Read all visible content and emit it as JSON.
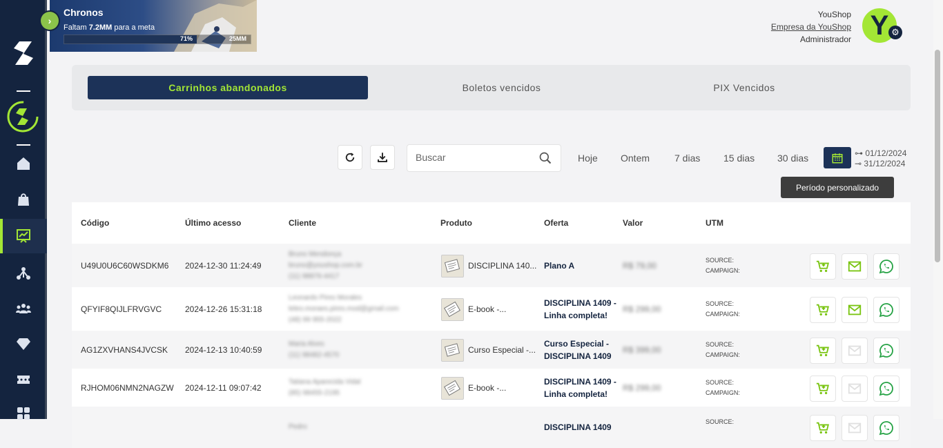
{
  "colors": {
    "accent": "#a3e635",
    "navy": "#14243f",
    "active_tab": "#1c3258",
    "whatsapp": "#25a244"
  },
  "banner": {
    "title": "Chronos",
    "sub_prefix": "Faltam ",
    "sub_amount": "7.2MM",
    "sub_suffix": " para a meta",
    "progress": 0.71,
    "progress_label": "71%",
    "goal_label": "25MM"
  },
  "user": {
    "name": "YouShop",
    "company": "Empresa da YouShop",
    "role": "Administrador",
    "avatar_letter": "Y"
  },
  "sidebar": {
    "items": [
      {
        "icon": "home-icon"
      },
      {
        "icon": "bag-icon"
      },
      {
        "icon": "presentation-chart-icon",
        "active": true
      },
      {
        "icon": "network-icon"
      },
      {
        "icon": "users-icon"
      },
      {
        "icon": "diamond-icon"
      },
      {
        "icon": "ticket-icon"
      },
      {
        "icon": "apps-icon"
      }
    ]
  },
  "tabs": [
    {
      "label": "Carrinhos abandonados",
      "active": true
    },
    {
      "label": "Boletos vencidos"
    },
    {
      "label": "PIX Vencidos"
    }
  ],
  "search": {
    "placeholder": "Buscar"
  },
  "periods": [
    "Hoje",
    "Ontem",
    "7 dias",
    "15 dias",
    "30 dias"
  ],
  "date_range": {
    "start": "01/12/2024",
    "end": "31/12/2024"
  },
  "tooltip": "Período personalizado",
  "table": {
    "headers": [
      "Código",
      "Último acesso",
      "Cliente",
      "Produto",
      "Oferta",
      "Valor",
      "UTM"
    ],
    "rows": [
      {
        "code": "U49U0U6C60WSDKM6",
        "last": "2024-12-30 11:24:49",
        "client": [
          "Bruno Mendonça",
          "bruno@youshop.com.br",
          "(11) 98876-4417"
        ],
        "product": "DISCIPLINA 140...",
        "offer": [
          "Plano A"
        ],
        "value": "R$ 79,00",
        "utm_source": "SOURCE:",
        "utm_campaign": "CAMPAIGN:",
        "email_enabled": true
      },
      {
        "code": "QFYIF8QIJLFRVGVC",
        "last": "2024-12-26 15:31:18",
        "client": [
          "Leonardo Pires Morales",
          "leleo.moraes.pires.mod@gmail.com",
          "(48) 99 955-2022"
        ],
        "product": "E-book -...",
        "offer": [
          "DISCIPLINA 1409 -",
          "Linha completa!"
        ],
        "value": "R$ 299,00",
        "utm_source": "SOURCE:",
        "utm_campaign": "CAMPAIGN:",
        "email_enabled": true
      },
      {
        "code": "AG1ZXVHANS4JVCSK",
        "last": "2024-12-13 10:40:59",
        "client": [
          "Maria Alves",
          "(11) 98482-4570"
        ],
        "product": "Curso Especial -...",
        "offer": [
          "Curso Especial -",
          "DISCIPLINA 1409"
        ],
        "value": "R$ 399,00",
        "utm_source": "SOURCE:",
        "utm_campaign": "CAMPAIGN:",
        "email_enabled": false
      },
      {
        "code": "RJHOM06NMN2NAGZW",
        "last": "2024-12-11 09:07:42",
        "client": [
          "Tatiana Aparecida Vidal",
          "(85) 98455-2195"
        ],
        "product": "E-book -...",
        "offer": [
          "DISCIPLINA 1409 -",
          "Linha completa!"
        ],
        "value": "R$ 299,00",
        "utm_source": "SOURCE:",
        "utm_campaign": "CAMPAIGN:",
        "email_enabled": false
      },
      {
        "code": "",
        "last": "",
        "client": [
          "Pedro"
        ],
        "product": "",
        "offer": [
          "DISCIPLINA 1409"
        ],
        "value": "",
        "utm_source": "SOURCE:",
        "utm_campaign": "",
        "email_enabled": false
      }
    ]
  }
}
